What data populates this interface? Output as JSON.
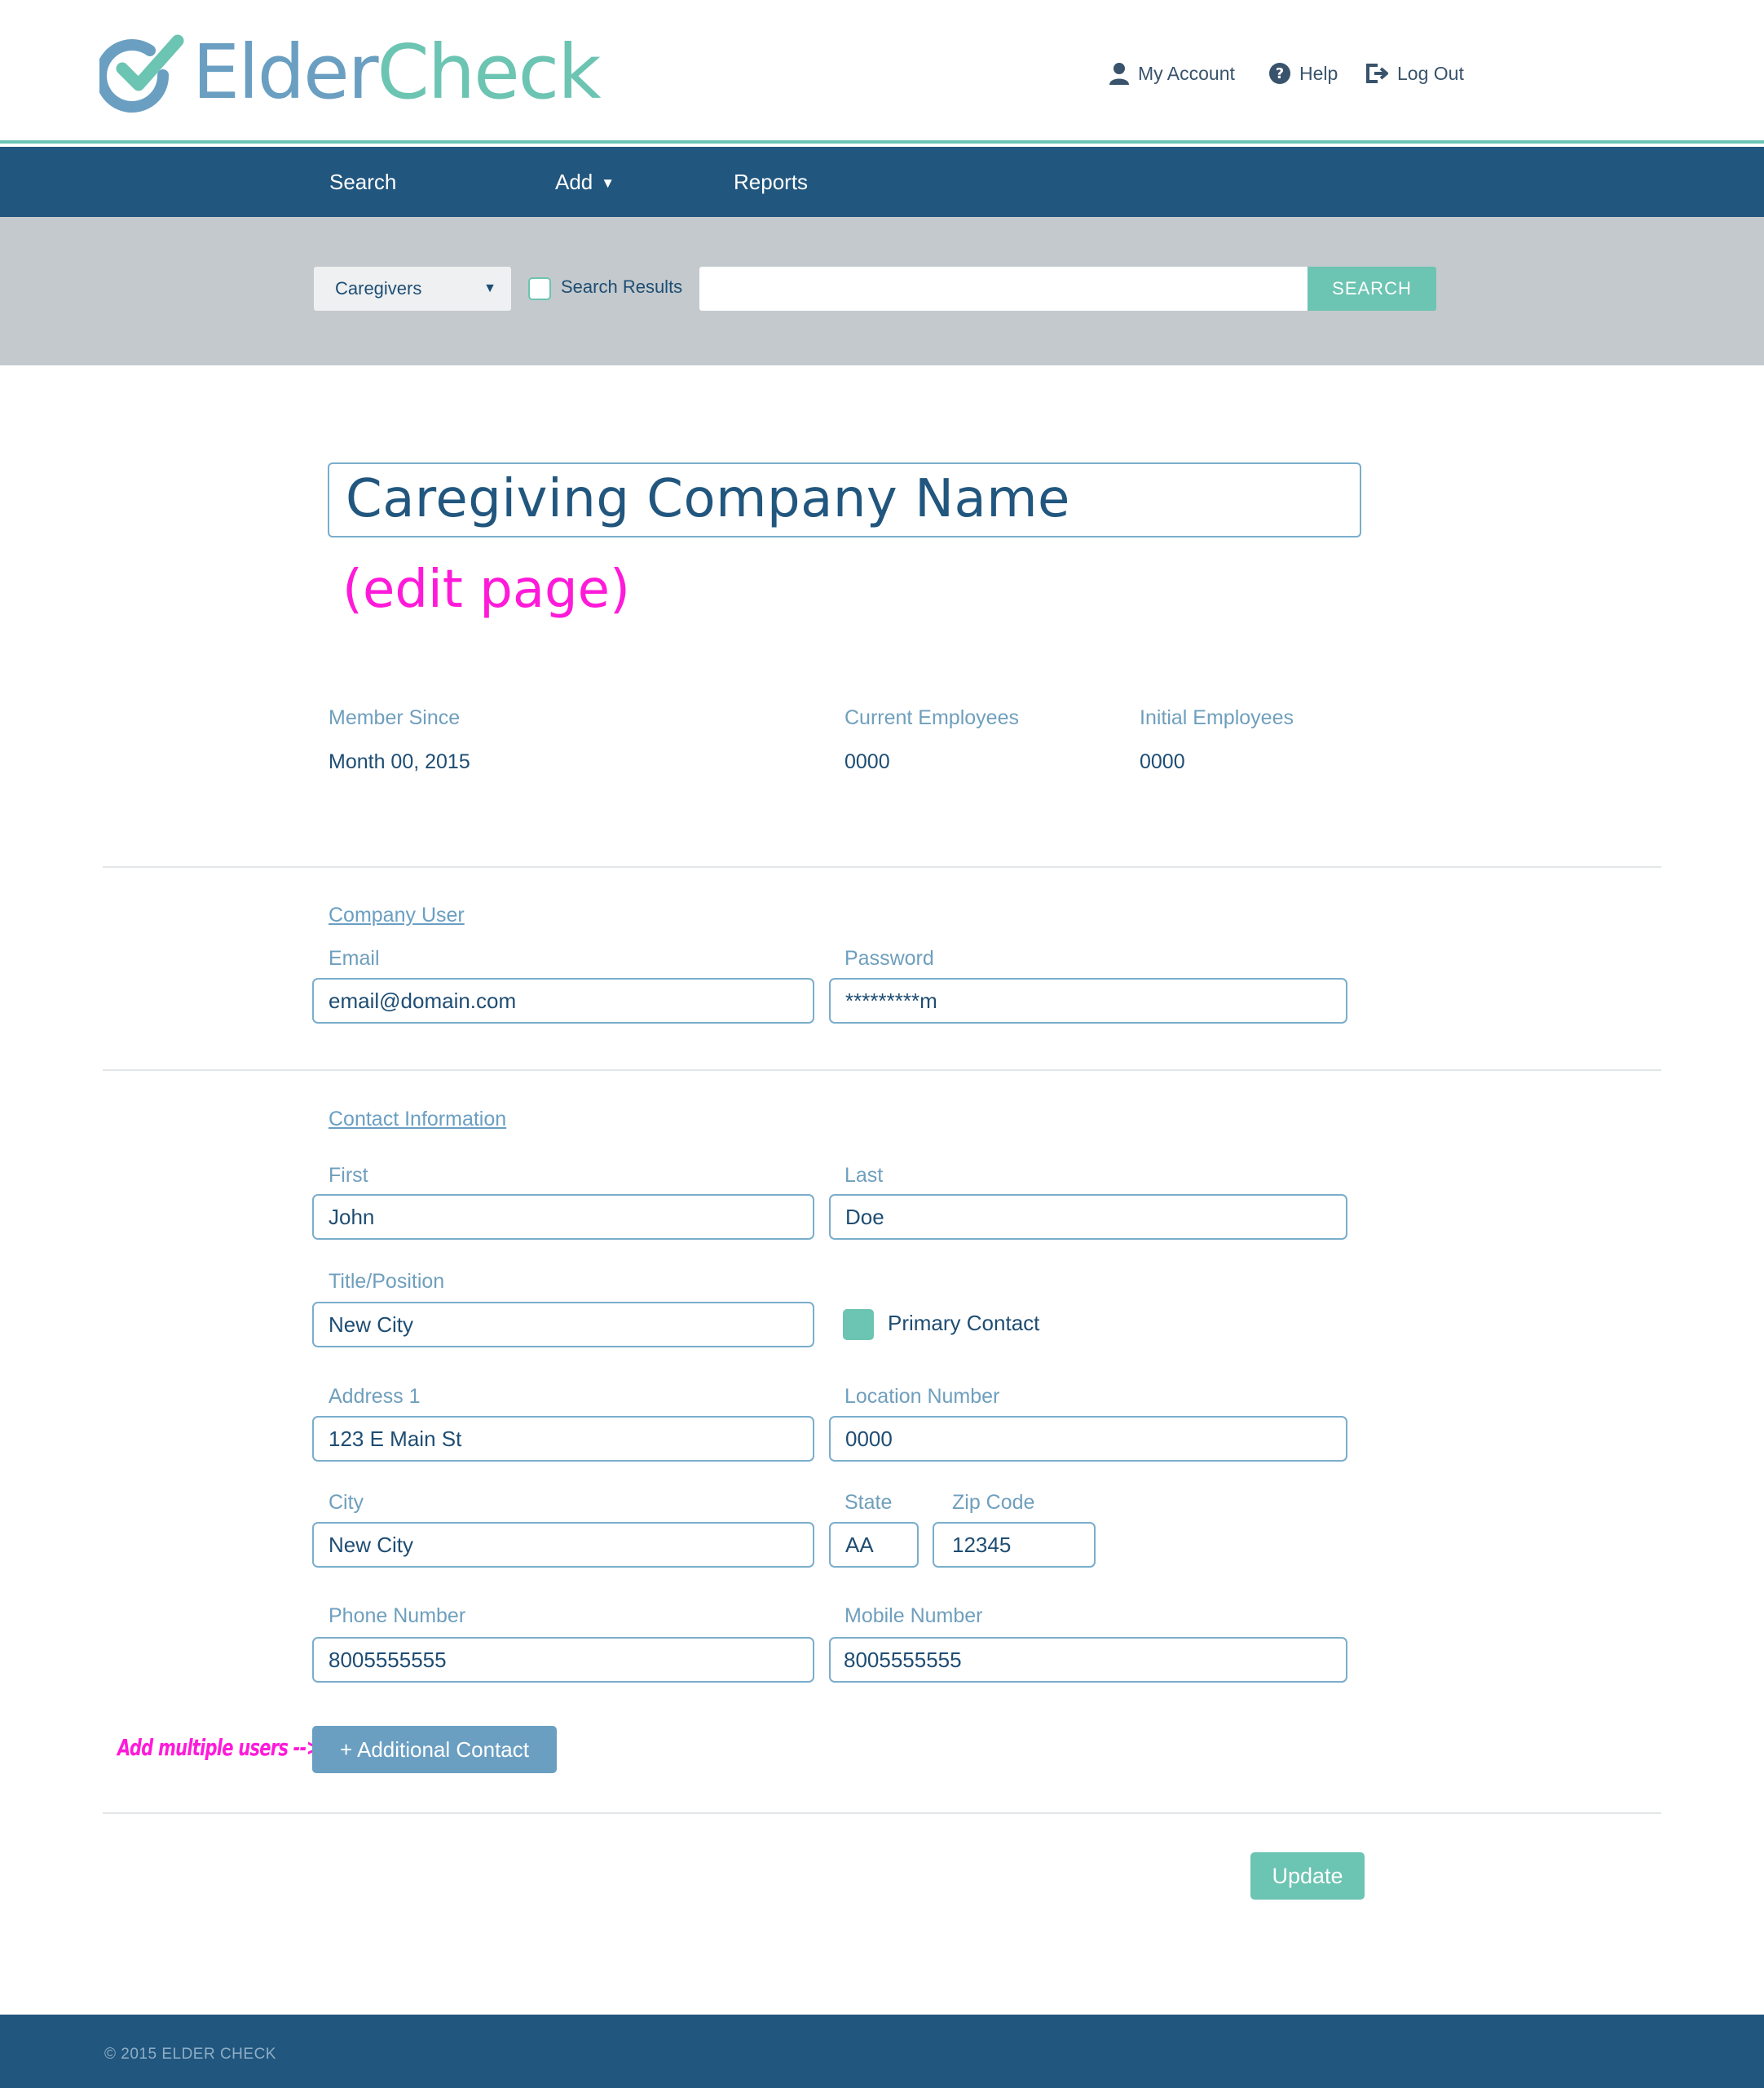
{
  "brand": {
    "name_part1": "Elder",
    "name_part2": "Check",
    "color_primary": "#6a9fc2",
    "color_accent": "#6cc4b2"
  },
  "top_links": {
    "account": {
      "label": "My Account",
      "icon": "user-icon"
    },
    "help": {
      "label": "Help",
      "icon": "question-circle-icon"
    },
    "logout": {
      "label": "Log Out",
      "icon": "logout-icon"
    }
  },
  "nav": {
    "search": "Search",
    "add": "Add",
    "reports": "Reports"
  },
  "search_bar": {
    "type_selected": "Caregivers",
    "checkbox_label": "Search Results",
    "checkbox_checked": false,
    "query_value": "",
    "button_label": "SEARCH"
  },
  "company": {
    "name": "Caregiving Company Name",
    "annotation": "(edit page)"
  },
  "stats": {
    "member_since_label": "Member Since",
    "member_since_value": "Month 00, 2015",
    "current_employees_label": "Current Employees",
    "current_employees_value": "0000",
    "initial_employees_label": "Initial Employees",
    "initial_employees_value": "0000"
  },
  "company_user": {
    "section_title": "Company User",
    "email_label": "Email",
    "email_value": "email@domain.com",
    "password_label": "Password",
    "password_value": "*********m"
  },
  "contact": {
    "section_title": "Contact Information",
    "first_label": "First",
    "first_value": "John",
    "last_label": "Last",
    "last_value": "Doe",
    "title_label": "Title/Position",
    "title_value": "New City",
    "primary_label": "Primary Contact",
    "primary_checked": true,
    "address_label": "Address 1",
    "address_value": "123 E Main St",
    "location_label": "Location Number",
    "location_value": "0000",
    "city_label": "City",
    "city_value": "New City",
    "state_label": "State",
    "state_value": "AA",
    "zip_label": "Zip Code",
    "zip_value": "12345",
    "phone_label": "Phone Number",
    "phone_value": "8005555555",
    "mobile_label": "Mobile Number",
    "mobile_value": "8005555555"
  },
  "actions": {
    "add_contact_label": "+ Additional Contact",
    "add_annotation": "Add multiple users -->",
    "update_label": "Update"
  },
  "footer": {
    "copyright": "© 2015 ELDER CHECK"
  }
}
